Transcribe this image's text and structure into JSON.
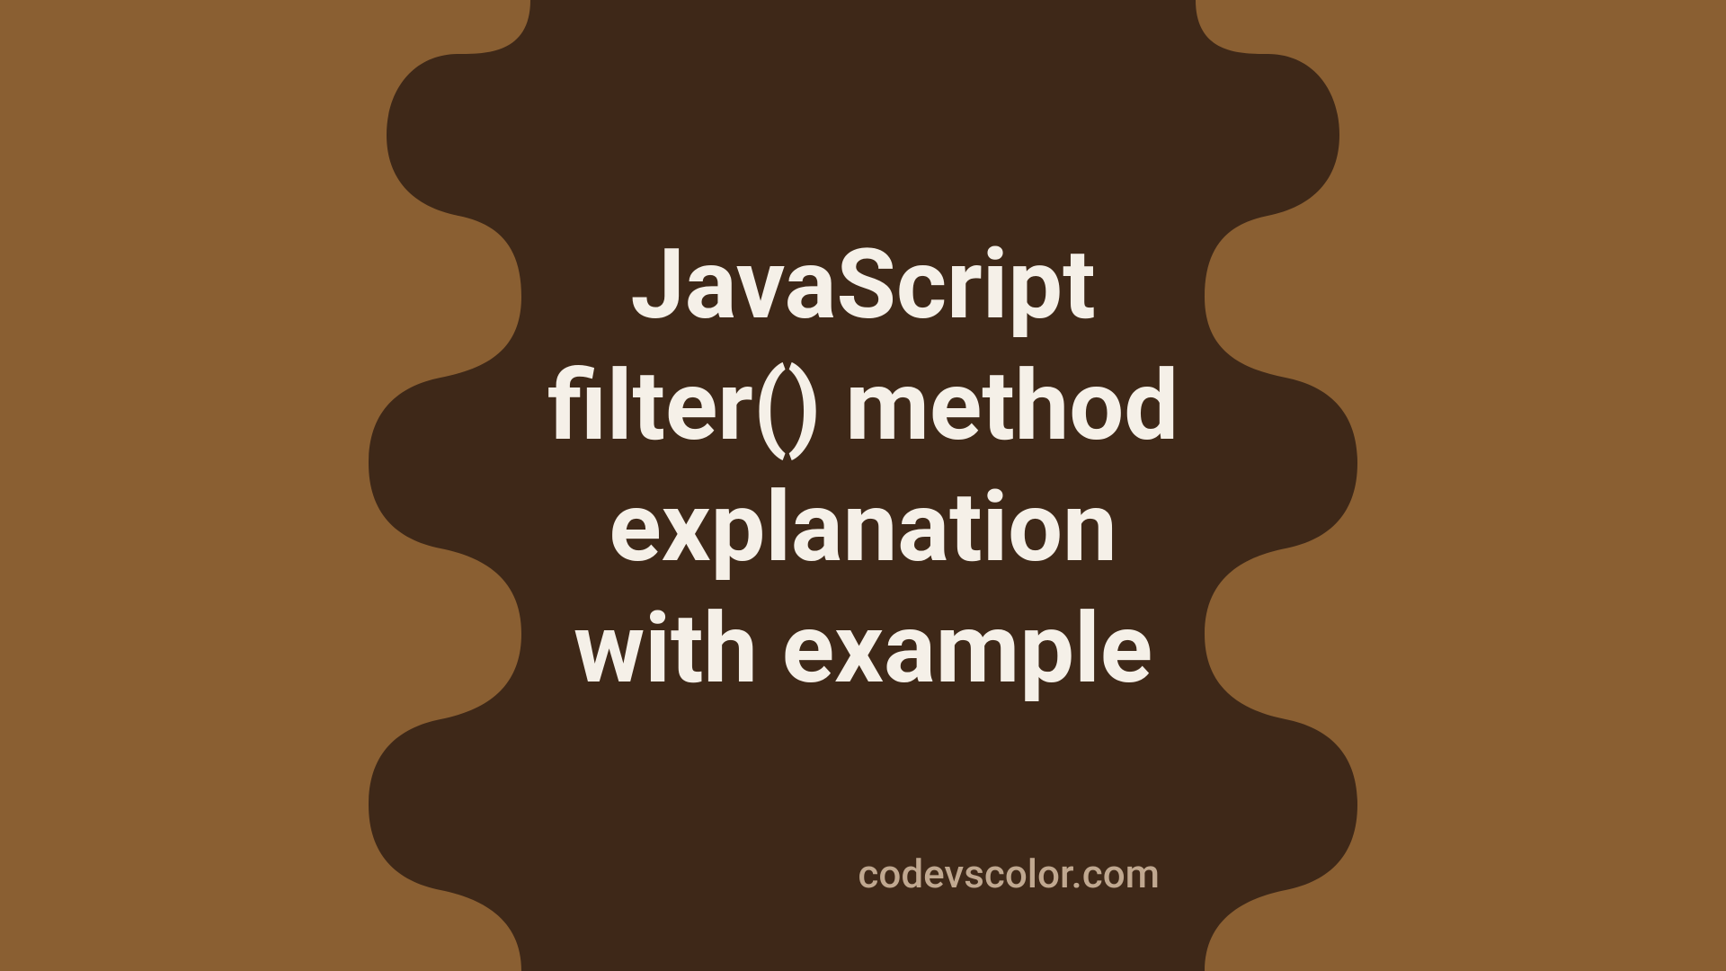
{
  "title": {
    "line1": "JavaScript",
    "line2": "filter() method",
    "line3": "explanation",
    "line4": "with example"
  },
  "site": "codevscolor.com",
  "colors": {
    "background": "#8a5f32",
    "shape": "#3e2818",
    "text": "#f5f0e8",
    "site_text": "#c0a890"
  }
}
